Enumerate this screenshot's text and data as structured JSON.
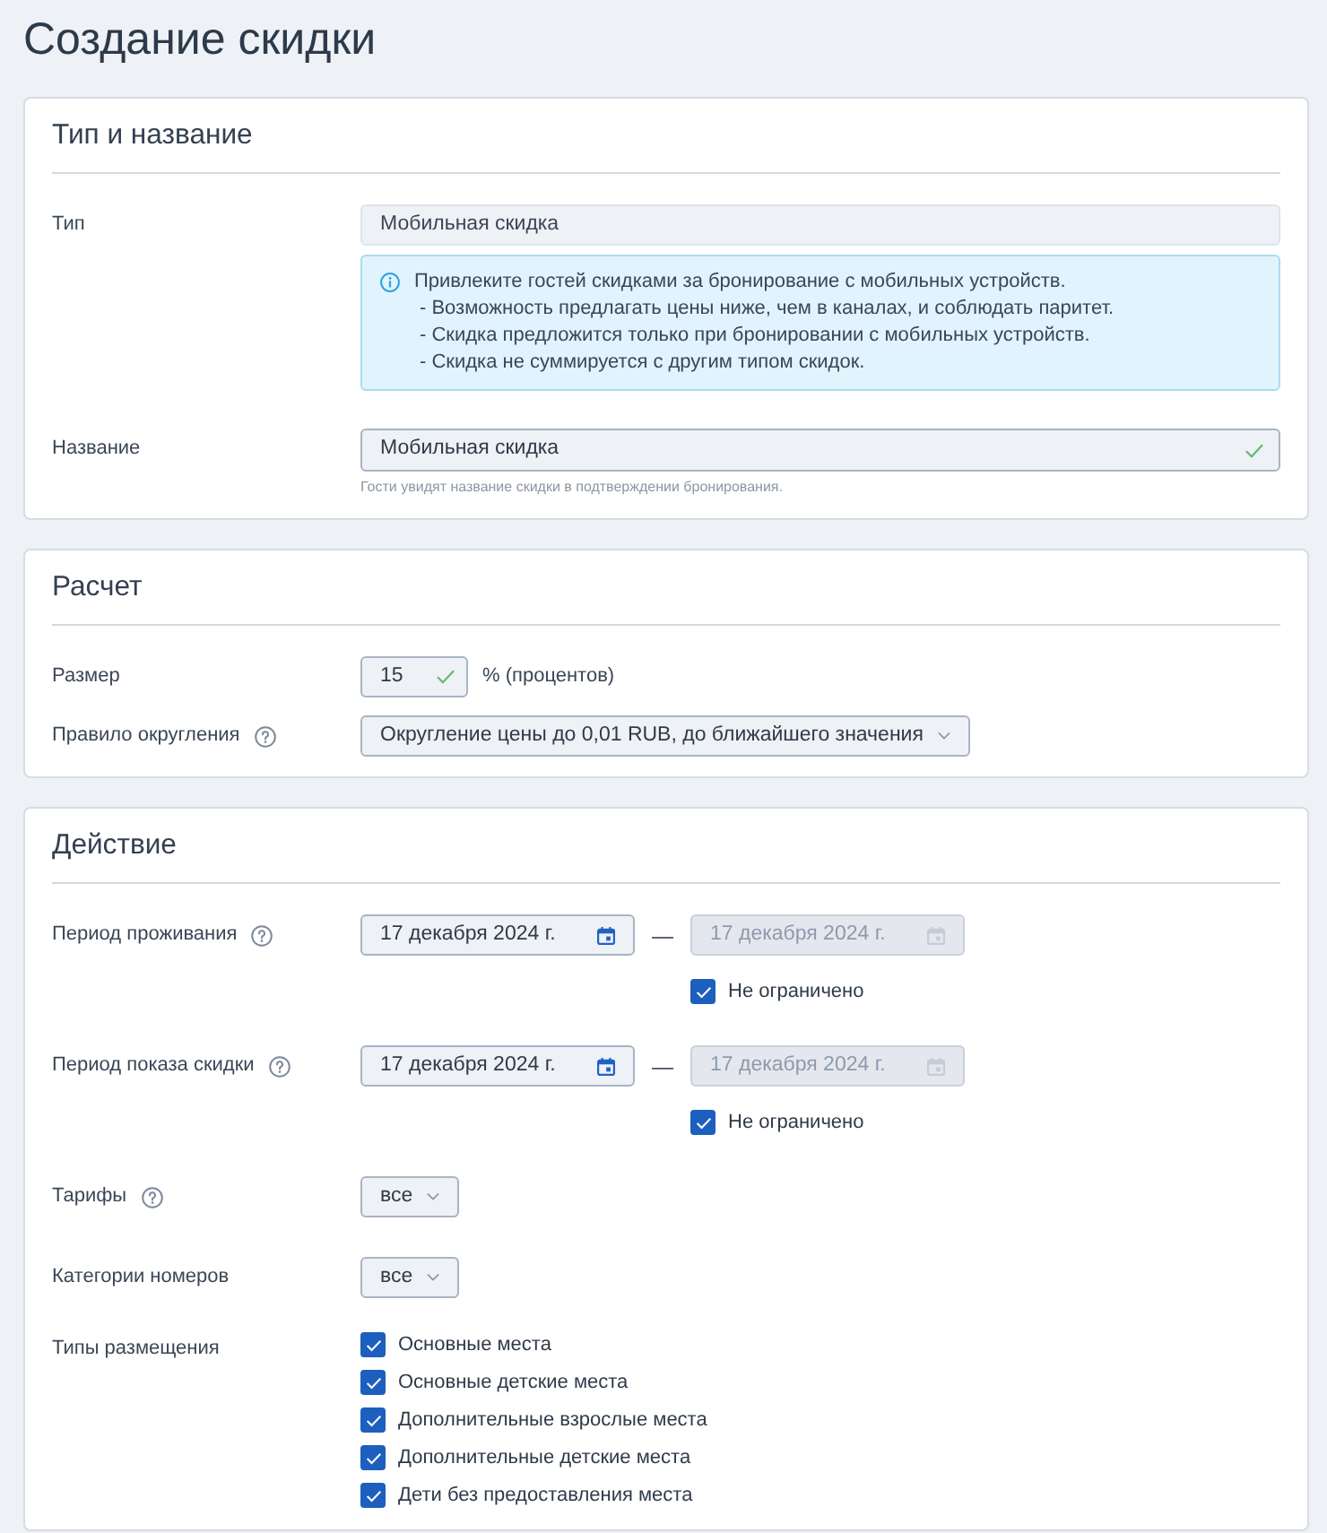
{
  "page": {
    "title": "Создание скидки"
  },
  "sections": [
    {
      "title": "Тип и название",
      "rows": [
        {
          "kind": "readonly",
          "label": "Тип",
          "help": false,
          "value": "Мобильная скидка",
          "info": [
            "Привлеките гостей скидками за бронирование с мобильных устройств.",
            "- Возможность предлагать цены ниже, чем в каналах, и соблюдать паритет.",
            "- Скидка предложится только при бронировании с мобильных устройств.",
            "- Скидка не суммируется с другим типом скидок."
          ]
        },
        {
          "kind": "text",
          "label": "Название",
          "help": false,
          "value": "Мобильная скидка",
          "valid": true,
          "hint": "Гости увидят название скидки в подтверждении бронирования."
        }
      ]
    },
    {
      "title": "Расчет",
      "rows": [
        {
          "kind": "number",
          "label": "Размер",
          "help": false,
          "value": "15",
          "valid": true,
          "unit": "% (процентов)"
        },
        {
          "kind": "select",
          "label": "Правило округления",
          "help": true,
          "value": "Округление цены до 0,01 RUB, до ближайшего значения"
        }
      ]
    },
    {
      "title": "Действие",
      "rows": [
        {
          "kind": "period",
          "label": "Период проживания",
          "help": true,
          "from": {
            "value": "17 декабря 2024 г.",
            "disabled": false
          },
          "separator": "—",
          "to": {
            "value": "17 декабря 2024 г.",
            "disabled": true
          },
          "unlimited": {
            "label": "Не ограничено",
            "checked": true
          }
        },
        {
          "kind": "period",
          "label": "Период показа скидки",
          "help": true,
          "from": {
            "value": "17 декабря 2024 г.",
            "disabled": false
          },
          "separator": "—",
          "to": {
            "value": "17 декабря 2024 г.",
            "disabled": true
          },
          "unlimited": {
            "label": "Не ограничено",
            "checked": true
          }
        },
        {
          "kind": "select",
          "label": "Тарифы",
          "help": true,
          "value": "все"
        },
        {
          "kind": "select",
          "label": "Категории номеров",
          "help": false,
          "value": "все"
        },
        {
          "kind": "checklist",
          "label": "Типы размещения",
          "help": false,
          "options": [
            {
              "label": "Основные места",
              "checked": true
            },
            {
              "label": "Основные детские места",
              "checked": true
            },
            {
              "label": "Дополнительные взрослые места",
              "checked": true
            },
            {
              "label": "Дополнительные детские места",
              "checked": true
            },
            {
              "label": "Дети без предоставления места",
              "checked": true
            }
          ]
        }
      ]
    }
  ]
}
